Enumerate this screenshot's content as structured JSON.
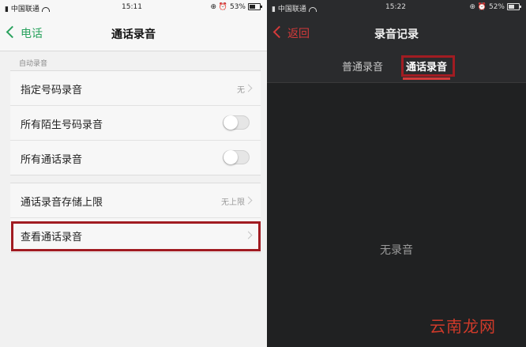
{
  "left_screen": {
    "status_bar": {
      "carrier": "中国联通",
      "time": "15:11",
      "battery": "53%"
    },
    "nav": {
      "back_label": "电话",
      "title": "通话录音"
    },
    "section_label": "自动录音",
    "auto_record_rows": [
      {
        "label": "指定号码录音",
        "value": "无"
      },
      {
        "label": "所有陌生号码录音"
      },
      {
        "label": "所有通话录音"
      }
    ],
    "storage_rows": [
      {
        "label": "通话录音存储上限",
        "value": "无上限"
      },
      {
        "label": "查看通话录音"
      }
    ]
  },
  "right_screen": {
    "status_bar": {
      "carrier": "中国联通",
      "time": "15:22",
      "battery": "52%"
    },
    "nav": {
      "back_label": "返回",
      "title": "录音记录"
    },
    "tabs": [
      {
        "label": "普通录音"
      },
      {
        "label": "通话录音"
      }
    ],
    "empty_text": "无录音"
  },
  "watermark": "云南龙网",
  "colors": {
    "accent_green": "#2aa25e",
    "accent_red": "#d43a3a",
    "highlight": "#a11c22"
  }
}
